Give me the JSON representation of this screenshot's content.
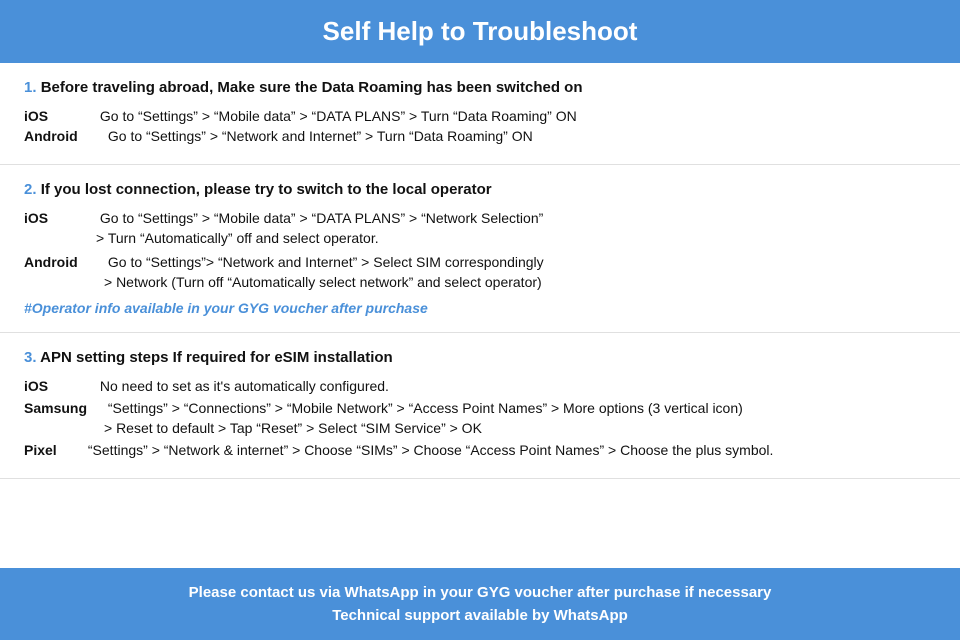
{
  "header": {
    "title": "Self Help to Troubleshoot"
  },
  "sections": [
    {
      "number": "1.",
      "title": "Before traveling abroad, Make sure the Data Roaming has been switched on",
      "items": [
        {
          "platform": "iOS",
          "lines": [
            "Go to “Settings” > “Mobile data” > “DATA PLANS” > Turn “Data Roaming” ON"
          ]
        },
        {
          "platform": "Android",
          "lines": [
            "Go to “Settings” > “Network and Internet” > Turn “Data Roaming” ON"
          ]
        }
      ]
    },
    {
      "number": "2.",
      "title": "If you lost connection, please try to switch to the local operator",
      "items": [
        {
          "platform": "iOS",
          "lines": [
            "Go to “Settings” > “Mobile data” > “DATA PLANS” > “Network Selection”",
            "> Turn “Automatically” off and select operator."
          ]
        },
        {
          "platform": "Android",
          "lines": [
            "Go to “Settings”>  “Network and Internet” > Select SIM correspondingly",
            "> Network (Turn off “Automatically select network” and select operator)"
          ]
        }
      ],
      "note": "#Operator info available in your GYG voucher after purchase"
    },
    {
      "number": "3.",
      "title": "APN setting steps If required for eSIM installation",
      "items": [
        {
          "platform": "iOS",
          "lines": [
            "No need to set as it's automatically configured."
          ]
        },
        {
          "platform": "Samsung",
          "lines": [
            "“Settings” > “Connections” > “Mobile Network” > “Access Point Names” > More options (3 vertical icon)",
            "> Reset to default > Tap “Reset” > Select “SIM Service” > OK"
          ]
        },
        {
          "platform": "Pixel",
          "lines": [
            "“Settings” > “Network & internet” > Choose “SIMs” > Choose “Access Point Names” > Choose the plus symbol."
          ]
        }
      ]
    }
  ],
  "footer": {
    "line1": "Please contact us via WhatsApp  in your GYG voucher after purchase if necessary",
    "line2": "Technical support available by WhatsApp"
  }
}
